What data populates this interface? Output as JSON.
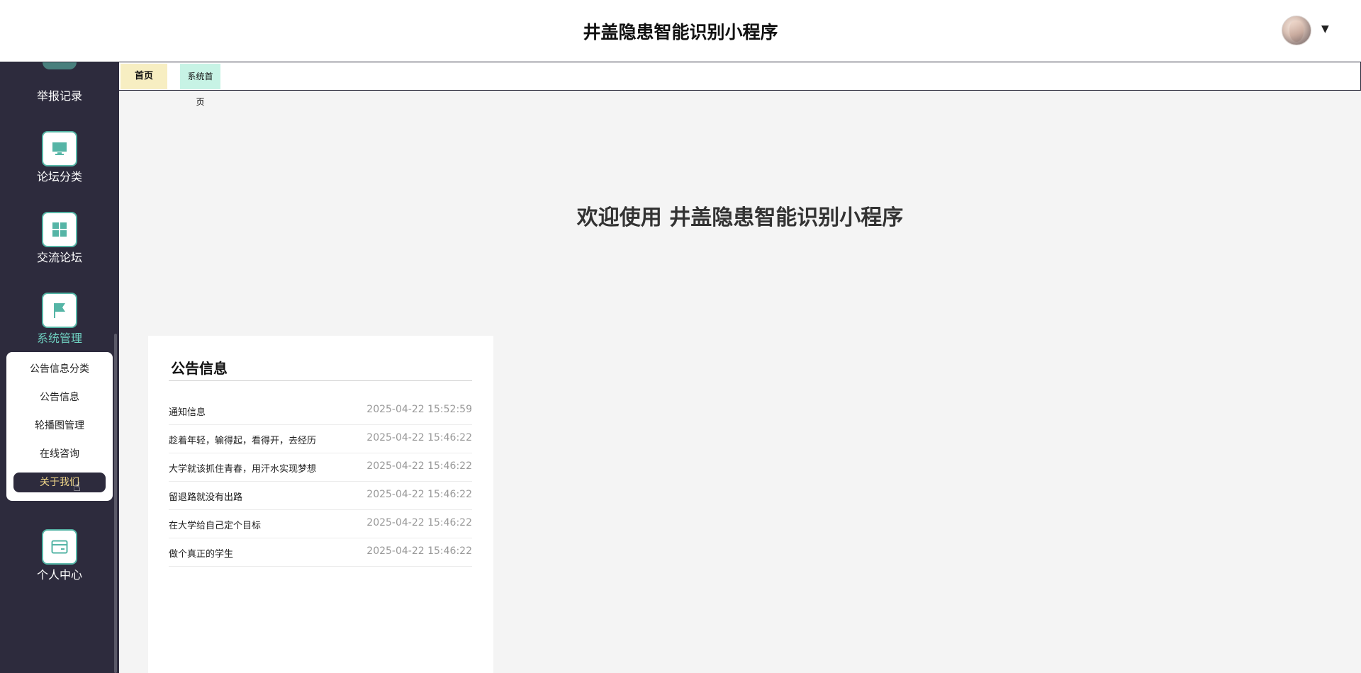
{
  "header": {
    "title": "井盖隐患智能识别小程序"
  },
  "sidebar": {
    "top_label": "举报记录",
    "items": [
      {
        "label": "论坛分类",
        "icon": "monitor-icon"
      },
      {
        "label": "交流论坛",
        "icon": "grid-icon"
      },
      {
        "label": "系统管理",
        "icon": "flag-icon"
      },
      {
        "label": "个人中心",
        "icon": "card-icon"
      }
    ],
    "submenu": [
      "公告信息分类",
      "公告信息",
      "轮播图管理",
      "在线咨询",
      "关于我们"
    ]
  },
  "tabs": [
    "首页",
    "系统首页"
  ],
  "main": {
    "welcome": "欢迎使用 井盖隐患智能识别小程序"
  },
  "notice": {
    "title": "公告信息",
    "rows": [
      {
        "title": "通知信息",
        "date": "2025-04-22 15:52:59"
      },
      {
        "title": "趁着年轻，输得起，看得开，去经历",
        "date": "2025-04-22 15:46:22"
      },
      {
        "title": "大学就该抓住青春，用汗水实现梦想",
        "date": "2025-04-22 15:46:22"
      },
      {
        "title": "留退路就没有出路",
        "date": "2025-04-22 15:46:22"
      },
      {
        "title": "在大学给自己定个目标",
        "date": "2025-04-22 15:46:22"
      },
      {
        "title": "做个真正的学生",
        "date": "2025-04-22 15:46:22"
      }
    ]
  },
  "colors": {
    "sidebar_bg": "#2d2b3d",
    "accent": "#55b5a6",
    "active_sub_text": "#f2d88a"
  }
}
